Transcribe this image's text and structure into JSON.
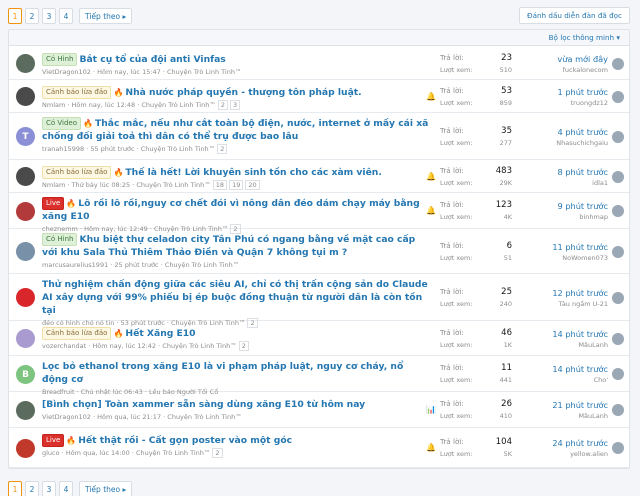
{
  "pagination": {
    "pages": [
      "1",
      "2",
      "3",
      "4"
    ],
    "next_label": "Tiếp theo ▸"
  },
  "mark_read_label": "Đánh dấu diễn đàn đã đọc",
  "filter_label": "Bộ lọc thông minh ▾",
  "stats_labels": {
    "replies": "Trả lời:",
    "views": "Lượt xem:"
  },
  "threads": [
    {
      "label": "Có Hình",
      "label_style": "green",
      "fire": false,
      "title": "Bắt cụ tổ của đội anti Vinfas",
      "author": "VietDragon102",
      "time": "Hôm nay, lúc 15:47",
      "forum": "Chuyện Trò Linh Tinh™",
      "pages": [],
      "status_icon": "",
      "replies": "23",
      "views": "510",
      "latest_time": "vừa mới đây",
      "latest_user": "fuckalonecom",
      "avatar_letter": "",
      "avatar_color": "#5b6b5d"
    },
    {
      "label": "Cảnh báo lừa đảo",
      "label_style": "yellow",
      "fire": true,
      "title": "Nhà nước pháp quyền - thượng tôn pháp luật.",
      "author": "Nmlam",
      "time": "Hôm nay, lúc 12:48",
      "forum": "Chuyện Trò Linh Tinh™",
      "pages": [
        "2",
        "3"
      ],
      "status_icon": "🔔",
      "replies": "53",
      "views": "859",
      "latest_time": "1 phút trước",
      "latest_user": "truongdz12",
      "avatar_letter": "",
      "avatar_color": "#4a4a4a"
    },
    {
      "label": "Có Video",
      "label_style": "green",
      "fire": true,
      "title": "Thắc mắc, nếu như cắt toàn bộ điện, nước, internet ở mấy cái xã chống đối giải toả thì dân có thể trụ được bao lâu",
      "author": "tranah15998",
      "time": "55 phút trước",
      "forum": "Chuyện Trò Linh Tinh™",
      "pages": [
        "2"
      ],
      "status_icon": "",
      "replies": "35",
      "views": "277",
      "latest_time": "4 phút trước",
      "latest_user": "Nhasuchichgaiu",
      "avatar_letter": "T",
      "avatar_color": "#8a8fd6"
    },
    {
      "label": "Cảnh báo lừa đảo",
      "label_style": "yellow",
      "fire": true,
      "title": "Thế là hết! Lời khuyên sinh tồn cho các xàm viên.",
      "author": "Nmlam",
      "time": "Thứ bảy lúc 08:25",
      "forum": "Chuyện Trò Linh Tinh™",
      "pages": [
        "18",
        "19",
        "20"
      ],
      "status_icon": "🔔",
      "replies": "483",
      "views": "29K",
      "latest_time": "8 phút trước",
      "latest_user": "idla1",
      "avatar_letter": "",
      "avatar_color": "#4a4a4a"
    },
    {
      "label": "Live",
      "label_style": "red",
      "fire": true,
      "title": "Lô rồi lô rồi,nguy cơ chết đói vì nông dân đéo dám chạy máy bằng xăng E10",
      "author": "cheznemm",
      "time": "Hôm nay, lúc 12:49",
      "forum": "Chuyện Trò Linh Tinh™",
      "pages": [
        "2"
      ],
      "status_icon": "🔔",
      "replies": "123",
      "views": "4K",
      "latest_time": "9 phút trước",
      "latest_user": "binhmap",
      "avatar_letter": "",
      "avatar_color": "#b33a3a"
    },
    {
      "label": "Có Hình",
      "label_style": "green",
      "fire": false,
      "title": "Khu biệt thự celadon city Tân Phú có ngang bằng về mặt cao cấp với khu Sala Thủ Thiêm Thảo Điền và Quận 7 không tụi m ?",
      "author": "marcusaurelius1991",
      "time": "25 phút trước",
      "forum": "Chuyện Trò Linh Tinh™",
      "pages": [],
      "status_icon": "",
      "replies": "6",
      "views": "51",
      "latest_time": "11 phút trước",
      "latest_user": "NoWomen073",
      "avatar_letter": "",
      "avatar_color": "#7890a8"
    },
    {
      "label": "",
      "label_style": "",
      "fire": false,
      "title": "Thử nghiệm chấn động giữa các siêu AI, chỉ có thị trấn cộng sản do Claude AI xây dựng với 99% phiếu bị ép buộc đồng thuận từ người dân là còn tồn tại",
      "author": "đéo có hình chó nó tin",
      "time": "53 phút trước",
      "forum": "Chuyện Trò Linh Tinh™",
      "pages": [
        "2"
      ],
      "status_icon": "",
      "replies": "25",
      "views": "240",
      "latest_time": "12 phút trước",
      "latest_user": "Tàu ngầm U-21",
      "avatar_letter": "",
      "avatar_color": "#d8262b"
    },
    {
      "label": "Cảnh báo lừa đảo",
      "label_style": "yellow",
      "fire": true,
      "title": "Hết Xăng E10",
      "author": "vozerchandat",
      "time": "Hôm nay, lúc 12:42",
      "forum": "Chuyện Trò Linh Tinh™",
      "pages": [
        "2"
      ],
      "status_icon": "",
      "replies": "46",
      "views": "1K",
      "latest_time": "14 phút trước",
      "latest_user": "MâuLanh",
      "avatar_letter": "",
      "avatar_color": "#a99ad0"
    },
    {
      "label": "",
      "label_style": "",
      "fire": false,
      "title": "Lọc bỏ ethanol trong xăng E10 là vi phạm pháp luật, nguy cơ cháy, nổ động cơ",
      "author": "Breadfruit",
      "time": "Chủ nhật lúc 06:43",
      "forum": "Lều báo Người Tối Cổ",
      "pages": [],
      "status_icon": "",
      "replies": "11",
      "views": "441",
      "latest_time": "14 phút trước",
      "latest_user": "Cho'",
      "avatar_letter": "B",
      "avatar_color": "#7cc47f"
    },
    {
      "label": "",
      "label_style": "",
      "fire": false,
      "title": "[Bình chọn] Toàn xammer sẵn sàng dùng xăng E10 từ hôm nay",
      "author": "VietDragon102",
      "time": "Hôm qua, lúc 21:17",
      "forum": "Chuyện Trò Linh Tinh™",
      "pages": [],
      "status_icon": "📊",
      "replies": "26",
      "views": "410",
      "latest_time": "21 phút trước",
      "latest_user": "MâuLanh",
      "avatar_letter": "",
      "avatar_color": "#5b6b5d"
    },
    {
      "label": "Live",
      "label_style": "red",
      "fire": true,
      "title": "Hết thật rồi - Cất gọn poster vào một góc",
      "author": "gluco",
      "time": "Hôm qua, lúc 14:00",
      "forum": "Chuyện Trò Linh Tinh™",
      "pages": [
        "2"
      ],
      "status_icon": "🔔",
      "replies": "104",
      "views": "5K",
      "latest_time": "24 phút trước",
      "latest_user": "yellow.alien",
      "avatar_letter": "",
      "avatar_color": "#c0392b"
    }
  ]
}
